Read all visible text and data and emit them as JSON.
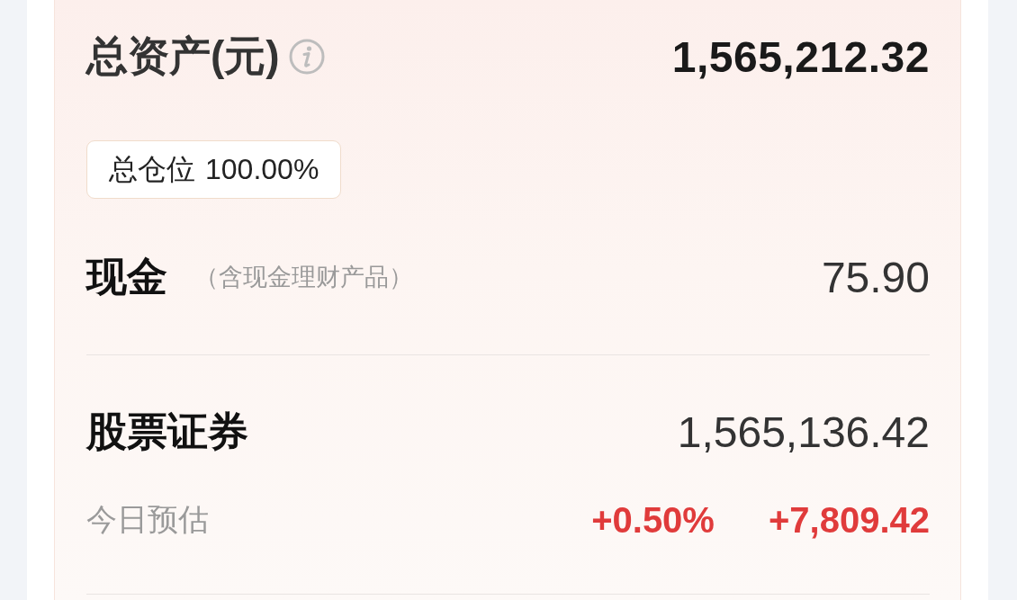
{
  "total_assets": {
    "label": "总资产(元)",
    "value": "1,565,212.32"
  },
  "position_badge": {
    "label": "总仓位",
    "value": "100.00%"
  },
  "cash": {
    "label": "现金",
    "note": "（含现金理财产品）",
    "value": "75.90"
  },
  "securities": {
    "label": "股票证券",
    "value": "1,565,136.42"
  },
  "today_estimate": {
    "label": "今日预估",
    "rising": true,
    "change_percent": "+0.50%",
    "change_amount": "+7,809.42"
  }
}
